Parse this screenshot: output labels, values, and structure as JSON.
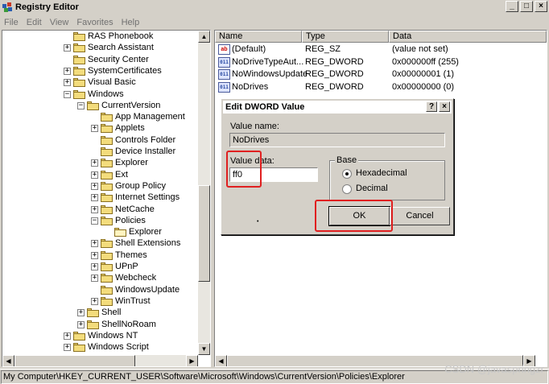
{
  "window": {
    "title": "Registry Editor",
    "minimize": "_",
    "maximize": "□",
    "close": "×"
  },
  "menu": [
    "File",
    "Edit",
    "View",
    "Favorites",
    "Help"
  ],
  "tree": [
    {
      "label": "RAS Phonebook",
      "level": 0,
      "expander": ""
    },
    {
      "label": "Search Assistant",
      "level": 0,
      "expander": "+"
    },
    {
      "label": "Security Center",
      "level": 0,
      "expander": ""
    },
    {
      "label": "SystemCertificates",
      "level": 0,
      "expander": "+"
    },
    {
      "label": "Visual Basic",
      "level": 0,
      "expander": "+"
    },
    {
      "label": "Windows",
      "level": 0,
      "expander": "−"
    },
    {
      "label": "CurrentVersion",
      "level": 1,
      "expander": "−"
    },
    {
      "label": "App Management",
      "level": 2,
      "expander": ""
    },
    {
      "label": "Applets",
      "level": 2,
      "expander": "+"
    },
    {
      "label": "Controls Folder",
      "level": 2,
      "expander": ""
    },
    {
      "label": "Device Installer",
      "level": 2,
      "expander": ""
    },
    {
      "label": "Explorer",
      "level": 2,
      "expander": "+"
    },
    {
      "label": "Ext",
      "level": 2,
      "expander": "+"
    },
    {
      "label": "Group Policy",
      "level": 2,
      "expander": "+"
    },
    {
      "label": "Internet Settings",
      "level": 2,
      "expander": "+"
    },
    {
      "label": "NetCache",
      "level": 2,
      "expander": "+"
    },
    {
      "label": "Policies",
      "level": 2,
      "expander": "−"
    },
    {
      "label": "Explorer",
      "level": 3,
      "expander": "",
      "open": true
    },
    {
      "label": "Shell Extensions",
      "level": 2,
      "expander": "+"
    },
    {
      "label": "Themes",
      "level": 2,
      "expander": "+"
    },
    {
      "label": "UPnP",
      "level": 2,
      "expander": "+"
    },
    {
      "label": "Webcheck",
      "level": 2,
      "expander": "+"
    },
    {
      "label": "WindowsUpdate",
      "level": 2,
      "expander": ""
    },
    {
      "label": "WinTrust",
      "level": 2,
      "expander": "+"
    },
    {
      "label": "Shell",
      "level": 1,
      "expander": "+"
    },
    {
      "label": "ShellNoRoam",
      "level": 1,
      "expander": "+"
    },
    {
      "label": "Windows NT",
      "level": 0,
      "expander": "+"
    },
    {
      "label": "Windows Script",
      "level": 0,
      "expander": "+"
    }
  ],
  "list": {
    "headers": [
      "Name",
      "Type",
      "Data"
    ],
    "rows": [
      {
        "icon": "ab",
        "name": "(Default)",
        "type": "REG_SZ",
        "data": "(value not set)"
      },
      {
        "icon": "011",
        "name": "NoDriveTypeAut...",
        "type": "REG_DWORD",
        "data": "0x000000ff (255)"
      },
      {
        "icon": "011",
        "name": "NoWindowsUpdate",
        "type": "REG_DWORD",
        "data": "0x00000001 (1)"
      },
      {
        "icon": "011",
        "name": "NoDrives",
        "type": "REG_DWORD",
        "data": "0x00000000 (0)"
      }
    ]
  },
  "dialog": {
    "title": "Edit DWORD Value",
    "help": "?",
    "close": "×",
    "value_name_label": "Value name:",
    "value_name": "NoDrives",
    "value_data_label": "Value data:",
    "value_data": "ff0",
    "base_label": "Base",
    "hex_label": "Hexadecimal",
    "dec_label": "Decimal",
    "base_selected": "Hexadecimal",
    "ok": "OK",
    "cancel": "Cancel",
    "dot": "•"
  },
  "status": "My Computer\\HKEY_CURRENT_USER\\Software\\Microsoft\\Windows\\CurrentVersion\\Policies\\Explorer",
  "watermark": "CSDN @javaspringzr",
  "scroll": {
    "up": "▲",
    "down": "▼",
    "left": "◀",
    "right": "▶"
  }
}
